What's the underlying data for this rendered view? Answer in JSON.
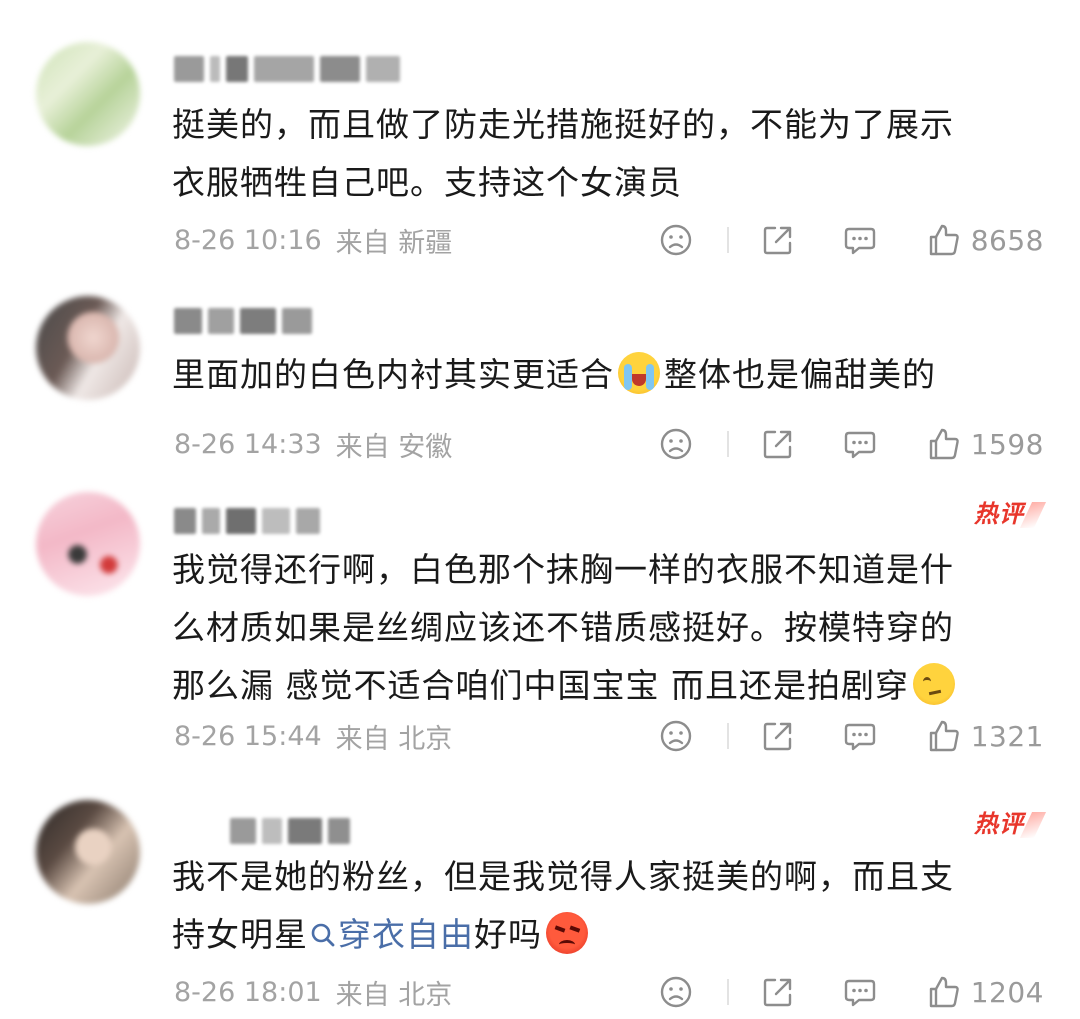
{
  "comments": [
    {
      "text": [
        "挺美的，而且做了防走光措施挺好的，不能为了展示",
        "衣服牺牲自己吧。支持这个女演员"
      ],
      "time": "8-26 10:16",
      "from": "来自 新疆",
      "likes": "8658",
      "hot": false
    },
    {
      "text_before_emoji": "里面加的白色内衬其实更适合",
      "emoji": "cry-laugh-emoji",
      "text_after_emoji": "整体也是偏甜美的",
      "time": "8-26 14:33",
      "from": "来自 安徽",
      "likes": "1598",
      "hot": false
    },
    {
      "text": [
        "我觉得还行啊，白色那个抹胸一样的衣服不知道是什",
        "么材质如果是丝绸应该还不错质感挺好。按模特穿的"
      ],
      "text_last_line": "那么漏 感觉不适合咱们中国宝宝 而且还是拍剧穿",
      "emoji": "doubt-emoji",
      "time": "8-26 15:44",
      "from": "来自 北京",
      "likes": "1321",
      "hot": true,
      "hot_label": "热评"
    },
    {
      "text": [
        "我不是她的粉丝，但是我觉得人家挺美的啊，而且支"
      ],
      "text_before_topic": "持女明星",
      "topic": "穿衣自由",
      "text_after_topic": "好吗",
      "emoji": "angry-emoji",
      "time": "8-26 18:01",
      "from": "来自 北京",
      "likes": "1204",
      "hot": true,
      "hot_label": "热评"
    }
  ],
  "colors": {
    "text": "#1a1a1a",
    "meta": "#a3a3a3",
    "topic": "#4a6ea8",
    "hot": "#e8362b"
  }
}
